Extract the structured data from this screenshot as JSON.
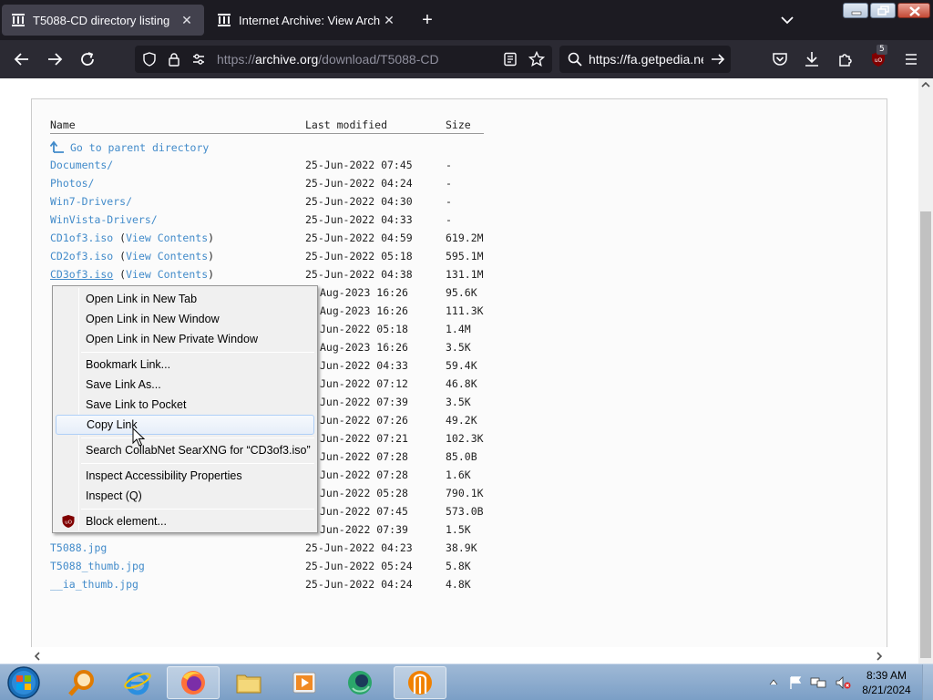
{
  "browser": {
    "tabs": [
      {
        "title": "T5088-CD directory listing",
        "active": true
      },
      {
        "title": "Internet Archive: View Archive",
        "active": false
      }
    ],
    "url": {
      "scheme": "https://",
      "host": "archive.org",
      "path": "/download/T5088-CD"
    },
    "search_text": "https://fa.getpedia.ne",
    "extension_badge": "5"
  },
  "listing": {
    "headers": {
      "name": "Name",
      "modified": "Last modified",
      "size": "Size"
    },
    "parent": "Go to parent directory",
    "rows": [
      {
        "name": "Documents/",
        "modified": "25-Jun-2022 07:45",
        "size": "-"
      },
      {
        "name": "Photos/",
        "modified": "25-Jun-2022 04:24",
        "size": "-"
      },
      {
        "name": "Win7-Drivers/",
        "modified": "25-Jun-2022 04:30",
        "size": "-"
      },
      {
        "name": "WinVista-Drivers/",
        "modified": "25-Jun-2022 04:33",
        "size": "-"
      },
      {
        "name": "CD1of3.iso",
        "view": "View Contents",
        "modified": "25-Jun-2022 04:59",
        "size": "619.2M"
      },
      {
        "name": "CD2of3.iso",
        "view": "View Contents",
        "modified": "25-Jun-2022 05:18",
        "size": "595.1M"
      },
      {
        "name": "CD3of3.iso",
        "view": "View Contents",
        "modified": "25-Jun-2022 04:38",
        "size": "131.1M"
      },
      {
        "modified": "Aug-2023 16:26",
        "size": "95.6K"
      },
      {
        "modified": "Aug-2023 16:26",
        "size": "111.3K"
      },
      {
        "modified": "Jun-2022 05:18",
        "size": "1.4M"
      },
      {
        "modified": "Aug-2023 16:26",
        "size": "3.5K"
      },
      {
        "modified": "Jun-2022 04:33",
        "size": "59.4K"
      },
      {
        "modified": "Jun-2022 07:12",
        "size": "46.8K"
      },
      {
        "modified": "Jun-2022 07:39",
        "size": "3.5K"
      },
      {
        "modified": "Jun-2022 07:26",
        "size": "49.2K"
      },
      {
        "modified": "Jun-2022 07:21",
        "size": "102.3K"
      },
      {
        "modified": "Jun-2022 07:28",
        "size": "85.0B"
      },
      {
        "modified": "Jun-2022 07:28",
        "size": "1.6K"
      },
      {
        "modified": "Jun-2022 05:28",
        "size": "790.1K"
      },
      {
        "modified": "Jun-2022 07:45",
        "size": "573.0B"
      },
      {
        "modified": "Jun-2022 07:39",
        "size": "1.5K"
      },
      {
        "name": "T5088.jpg",
        "modified": "25-Jun-2022 04:23",
        "size": "38.9K"
      },
      {
        "name": "T5088_thumb.jpg",
        "modified": "25-Jun-2022 05:24",
        "size": "5.8K"
      },
      {
        "name": "__ia_thumb.jpg",
        "modified": "25-Jun-2022 04:24",
        "size": "4.8K"
      }
    ]
  },
  "context_menu": {
    "items": [
      {
        "label": "Open Link in New Tab"
      },
      {
        "label": "Open Link in New Window"
      },
      {
        "label": "Open Link in New Private Window"
      },
      {
        "label": "Bookmark Link..."
      },
      {
        "label": "Save Link As..."
      },
      {
        "label": "Save Link to Pocket"
      },
      {
        "label": "Copy Link",
        "hovered": true
      },
      {
        "label": "Search CollabNet SearXNG for “CD3of3.iso”"
      },
      {
        "label": "Inspect Accessibility Properties"
      },
      {
        "label": "Inspect (Q)"
      },
      {
        "label": "Block element..."
      }
    ]
  },
  "taskbar": {
    "apps": [
      "start",
      "search-app",
      "internet-explorer",
      "firefox",
      "file-explorer",
      "media-player",
      "app-green",
      "app-orange"
    ],
    "time": "8:39 AM",
    "date": "8/21/2024"
  },
  "colors": {
    "link": "#428bca",
    "tab_bg": "#1c1b22",
    "nav_bg": "#2b2a33",
    "ublock": "#800000"
  }
}
